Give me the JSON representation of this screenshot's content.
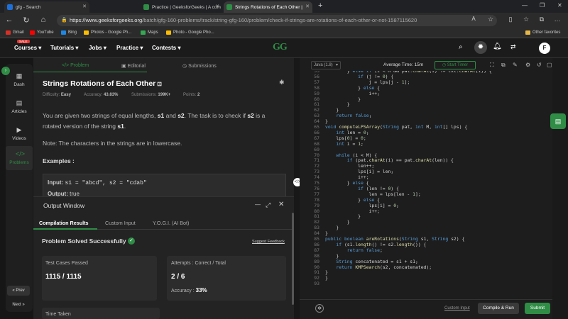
{
  "browser": {
    "tabs": [
      {
        "title": "gfg - Search"
      },
      {
        "title": "Practice | GeeksforGeeks | A com"
      },
      {
        "title": "Strings Rotations of Each Other |"
      }
    ],
    "url_host": "https://www.geeksforgeeks.org",
    "url_path": "/batch/gfg-160-problems/track/string-gfg-160/problem/check-if-strings-are-rotations-of-each-other-or-not-1587115620",
    "bookmarks": [
      "Gmail",
      "YouTube",
      "Bing",
      "Photos - Google Ph...",
      "Maps",
      "Photo - Google Pho..."
    ],
    "other_favorites": "Other favorites"
  },
  "topnav": {
    "sale_badge": "SALE",
    "items": [
      "Courses",
      "Tutorials",
      "Jobs",
      "Practice",
      "Contests"
    ],
    "logo": "GG",
    "avatar": "F"
  },
  "sidebar": {
    "items": [
      {
        "label": "Dash",
        "icon": "dashboard-icon"
      },
      {
        "label": "Articles",
        "icon": "article-icon"
      },
      {
        "label": "Videos",
        "icon": "video-icon"
      },
      {
        "label": "Problems",
        "icon": "code-icon"
      }
    ],
    "prev": "« Prev",
    "next": "Next »"
  },
  "problem": {
    "tabs": [
      "Problem",
      "Editorial",
      "Submissions"
    ],
    "title": "Strings Rotations of Each Other",
    "difficulty_label": "Difficulty:",
    "difficulty": "Easy",
    "accuracy_label": "Accuracy:",
    "accuracy": "43.83%",
    "submissions_label": "Submissions:",
    "submissions": "199K+",
    "points_label": "Points:",
    "points": "2",
    "desc_1": "You are given two strings of equal lengths,",
    "s1": "s1",
    "and": "and",
    "s2": "s2",
    "desc_2": ". The task is to check if",
    "desc_3": "is a",
    "desc_4": "rotated version of the string",
    "desc_5": ".",
    "note": "Note: The characters in the strings are in lowercase.",
    "examples": "Examples :",
    "input_label": "Input:",
    "input_value": "s1 = \"abcd\", s2 = \"cdab\"",
    "output_label": "Output:",
    "output_value": "true"
  },
  "output_window": {
    "title": "Output Window",
    "tabs": [
      "Compilation Results",
      "Custom Input",
      "Y.O.G.I. (AI Bot)"
    ],
    "status": "Problem Solved Successfully",
    "suggest": "Suggest Feedback",
    "test_cases_label": "Test Cases Passed",
    "test_cases": "1115 / 1115",
    "attempts_label": "Attempts : Correct / Total",
    "attempts": "2 / 6",
    "accuracy_label": "Accuracy :",
    "accuracy": "33%",
    "time_label": "Time Taken"
  },
  "editor": {
    "language": "Java (1.8)",
    "avg_time": "Average Time: 15m",
    "start_timer": "Start Timer",
    "first_line": 55,
    "lines": [
      "        } else if (i < M && pat.charAt(i) != txt.charAt(i)) {",
      "            if (j != 0) {",
      "                j = lps[j - 1];",
      "            } else {",
      "                i++;",
      "            }",
      "        }",
      "    }",
      "    return false;",
      "}",
      "void computeLPSArray(String pat, int M, int[] lps) {",
      "    int len = 0;",
      "    lps[0] = 0;",
      "    int i = 1;",
      "",
      "    while (i < M) {",
      "        if (pat.charAt(i) == pat.charAt(len)) {",
      "            len++;",
      "            lps[i] = len;",
      "            i++;",
      "        } else {",
      "            if (len != 0) {",
      "                len = lps[len - 1];",
      "            } else {",
      "                lps[i] = 0;",
      "                i++;",
      "            }",
      "        }",
      "    }",
      "}",
      "public boolean areRotations(String s1, String s2) {",
      "    if (s1.length() != s2.length()) {",
      "        return false;",
      "    }",
      "    String concatenated = s1 + s1;",
      "    return KMPSearch(s2, concatenated);",
      "}",
      "}",
      ""
    ],
    "custom_input": "Custom Input",
    "compile_run": "Compile & Run",
    "submit": "Submit"
  },
  "colors": {
    "accent": "#2f8d46",
    "bg": "#1e1e1e"
  }
}
